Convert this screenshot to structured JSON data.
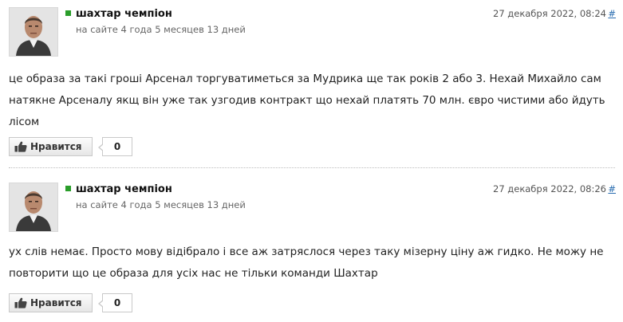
{
  "comments": [
    {
      "author": "шахтар чемпіон",
      "membership": "на сайте 4 года 5 месяцев 13 дней",
      "timestamp": "27 декабря 2022, 08:24",
      "permalink": "#",
      "text": "це образа за такі гроші Арсенал торгуватиметься за Мудрика ще так років 2 або 3. Нехай Михайло сам натякне Арсеналу якщ він уже так узгодив контракт що нехай платять 70 млн. євро чистими або йдуть лісом",
      "like_label": "Нравится",
      "like_count": "0"
    },
    {
      "author": "шахтар чемпіон",
      "membership": "на сайте 4 года 5 месяцев 13 дней",
      "timestamp": "27 декабря 2022, 08:26",
      "permalink": "#",
      "text": "ух слів немає. Просто мову відібрало і все аж затряслося через таку мізерну ціну аж гидко. Не можу не повторити що це образа для усіх нас не тільки команди Шахтар",
      "like_label": "Нравится",
      "like_count": "0"
    }
  ],
  "colors": {
    "online": "#2a9d2a",
    "link": "#2a6db0",
    "button_border": "#c9c9c9"
  },
  "icons": {
    "like": "thumbs-up-icon",
    "online": "online-status-icon",
    "avatar": "user-avatar"
  }
}
